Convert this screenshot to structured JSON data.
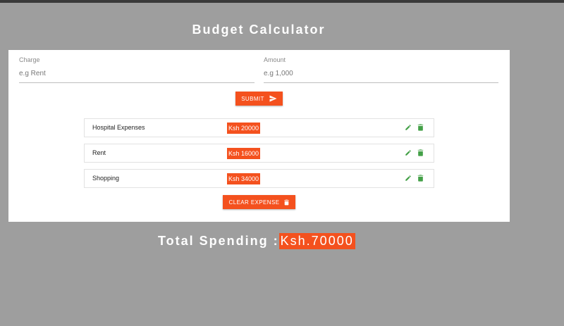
{
  "app": {
    "title": "Budget Calculator"
  },
  "form": {
    "charge": {
      "label": "Charge",
      "placeholder": "e.g Rent",
      "value": ""
    },
    "amount": {
      "label": "Amount",
      "placeholder": "e.g 1,000",
      "value": ""
    },
    "submit_label": "SUBMIT"
  },
  "expenses": [
    {
      "name": "Hospital Expenses",
      "amount": "Ksh 20000"
    },
    {
      "name": "Rent",
      "amount": "Ksh 16000"
    },
    {
      "name": "Shopping",
      "amount": "Ksh 34000"
    }
  ],
  "clear_label": "CLEAR EXPENSE",
  "total": {
    "label": "Total Spending :",
    "value": "Ksh.70000"
  },
  "colors": {
    "accent": "#f4511e",
    "icon_green": "#43a047",
    "background": "#9e9e9e"
  },
  "icons": [
    "send-icon",
    "edit-icon",
    "delete-icon"
  ]
}
